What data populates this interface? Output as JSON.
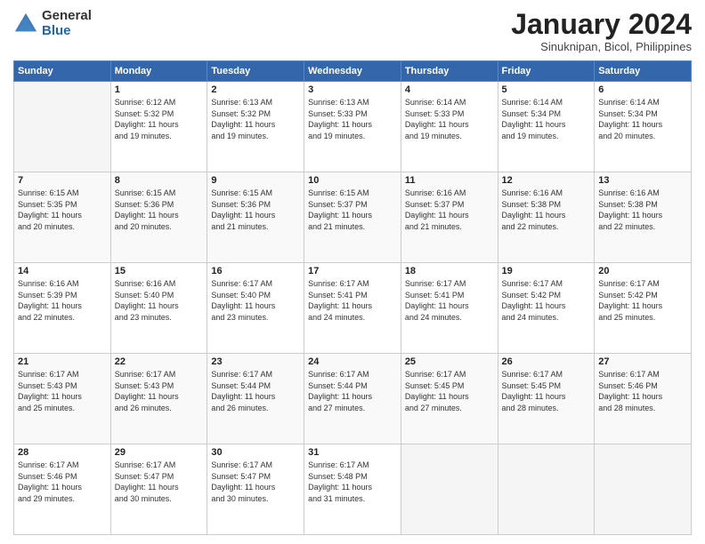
{
  "logo": {
    "general": "General",
    "blue": "Blue"
  },
  "title": "January 2024",
  "subtitle": "Sinuknipan, Bicol, Philippines",
  "days_header": [
    "Sunday",
    "Monday",
    "Tuesday",
    "Wednesday",
    "Thursday",
    "Friday",
    "Saturday"
  ],
  "weeks": [
    [
      {
        "day": "",
        "info": ""
      },
      {
        "day": "1",
        "info": "Sunrise: 6:12 AM\nSunset: 5:32 PM\nDaylight: 11 hours\nand 19 minutes."
      },
      {
        "day": "2",
        "info": "Sunrise: 6:13 AM\nSunset: 5:32 PM\nDaylight: 11 hours\nand 19 minutes."
      },
      {
        "day": "3",
        "info": "Sunrise: 6:13 AM\nSunset: 5:33 PM\nDaylight: 11 hours\nand 19 minutes."
      },
      {
        "day": "4",
        "info": "Sunrise: 6:14 AM\nSunset: 5:33 PM\nDaylight: 11 hours\nand 19 minutes."
      },
      {
        "day": "5",
        "info": "Sunrise: 6:14 AM\nSunset: 5:34 PM\nDaylight: 11 hours\nand 19 minutes."
      },
      {
        "day": "6",
        "info": "Sunrise: 6:14 AM\nSunset: 5:34 PM\nDaylight: 11 hours\nand 20 minutes."
      }
    ],
    [
      {
        "day": "7",
        "info": "Sunrise: 6:15 AM\nSunset: 5:35 PM\nDaylight: 11 hours\nand 20 minutes."
      },
      {
        "day": "8",
        "info": "Sunrise: 6:15 AM\nSunset: 5:36 PM\nDaylight: 11 hours\nand 20 minutes."
      },
      {
        "day": "9",
        "info": "Sunrise: 6:15 AM\nSunset: 5:36 PM\nDaylight: 11 hours\nand 21 minutes."
      },
      {
        "day": "10",
        "info": "Sunrise: 6:15 AM\nSunset: 5:37 PM\nDaylight: 11 hours\nand 21 minutes."
      },
      {
        "day": "11",
        "info": "Sunrise: 6:16 AM\nSunset: 5:37 PM\nDaylight: 11 hours\nand 21 minutes."
      },
      {
        "day": "12",
        "info": "Sunrise: 6:16 AM\nSunset: 5:38 PM\nDaylight: 11 hours\nand 22 minutes."
      },
      {
        "day": "13",
        "info": "Sunrise: 6:16 AM\nSunset: 5:38 PM\nDaylight: 11 hours\nand 22 minutes."
      }
    ],
    [
      {
        "day": "14",
        "info": "Sunrise: 6:16 AM\nSunset: 5:39 PM\nDaylight: 11 hours\nand 22 minutes."
      },
      {
        "day": "15",
        "info": "Sunrise: 6:16 AM\nSunset: 5:40 PM\nDaylight: 11 hours\nand 23 minutes."
      },
      {
        "day": "16",
        "info": "Sunrise: 6:17 AM\nSunset: 5:40 PM\nDaylight: 11 hours\nand 23 minutes."
      },
      {
        "day": "17",
        "info": "Sunrise: 6:17 AM\nSunset: 5:41 PM\nDaylight: 11 hours\nand 24 minutes."
      },
      {
        "day": "18",
        "info": "Sunrise: 6:17 AM\nSunset: 5:41 PM\nDaylight: 11 hours\nand 24 minutes."
      },
      {
        "day": "19",
        "info": "Sunrise: 6:17 AM\nSunset: 5:42 PM\nDaylight: 11 hours\nand 24 minutes."
      },
      {
        "day": "20",
        "info": "Sunrise: 6:17 AM\nSunset: 5:42 PM\nDaylight: 11 hours\nand 25 minutes."
      }
    ],
    [
      {
        "day": "21",
        "info": "Sunrise: 6:17 AM\nSunset: 5:43 PM\nDaylight: 11 hours\nand 25 minutes."
      },
      {
        "day": "22",
        "info": "Sunrise: 6:17 AM\nSunset: 5:43 PM\nDaylight: 11 hours\nand 26 minutes."
      },
      {
        "day": "23",
        "info": "Sunrise: 6:17 AM\nSunset: 5:44 PM\nDaylight: 11 hours\nand 26 minutes."
      },
      {
        "day": "24",
        "info": "Sunrise: 6:17 AM\nSunset: 5:44 PM\nDaylight: 11 hours\nand 27 minutes."
      },
      {
        "day": "25",
        "info": "Sunrise: 6:17 AM\nSunset: 5:45 PM\nDaylight: 11 hours\nand 27 minutes."
      },
      {
        "day": "26",
        "info": "Sunrise: 6:17 AM\nSunset: 5:45 PM\nDaylight: 11 hours\nand 28 minutes."
      },
      {
        "day": "27",
        "info": "Sunrise: 6:17 AM\nSunset: 5:46 PM\nDaylight: 11 hours\nand 28 minutes."
      }
    ],
    [
      {
        "day": "28",
        "info": "Sunrise: 6:17 AM\nSunset: 5:46 PM\nDaylight: 11 hours\nand 29 minutes."
      },
      {
        "day": "29",
        "info": "Sunrise: 6:17 AM\nSunset: 5:47 PM\nDaylight: 11 hours\nand 30 minutes."
      },
      {
        "day": "30",
        "info": "Sunrise: 6:17 AM\nSunset: 5:47 PM\nDaylight: 11 hours\nand 30 minutes."
      },
      {
        "day": "31",
        "info": "Sunrise: 6:17 AM\nSunset: 5:48 PM\nDaylight: 11 hours\nand 31 minutes."
      },
      {
        "day": "",
        "info": ""
      },
      {
        "day": "",
        "info": ""
      },
      {
        "day": "",
        "info": ""
      }
    ]
  ]
}
